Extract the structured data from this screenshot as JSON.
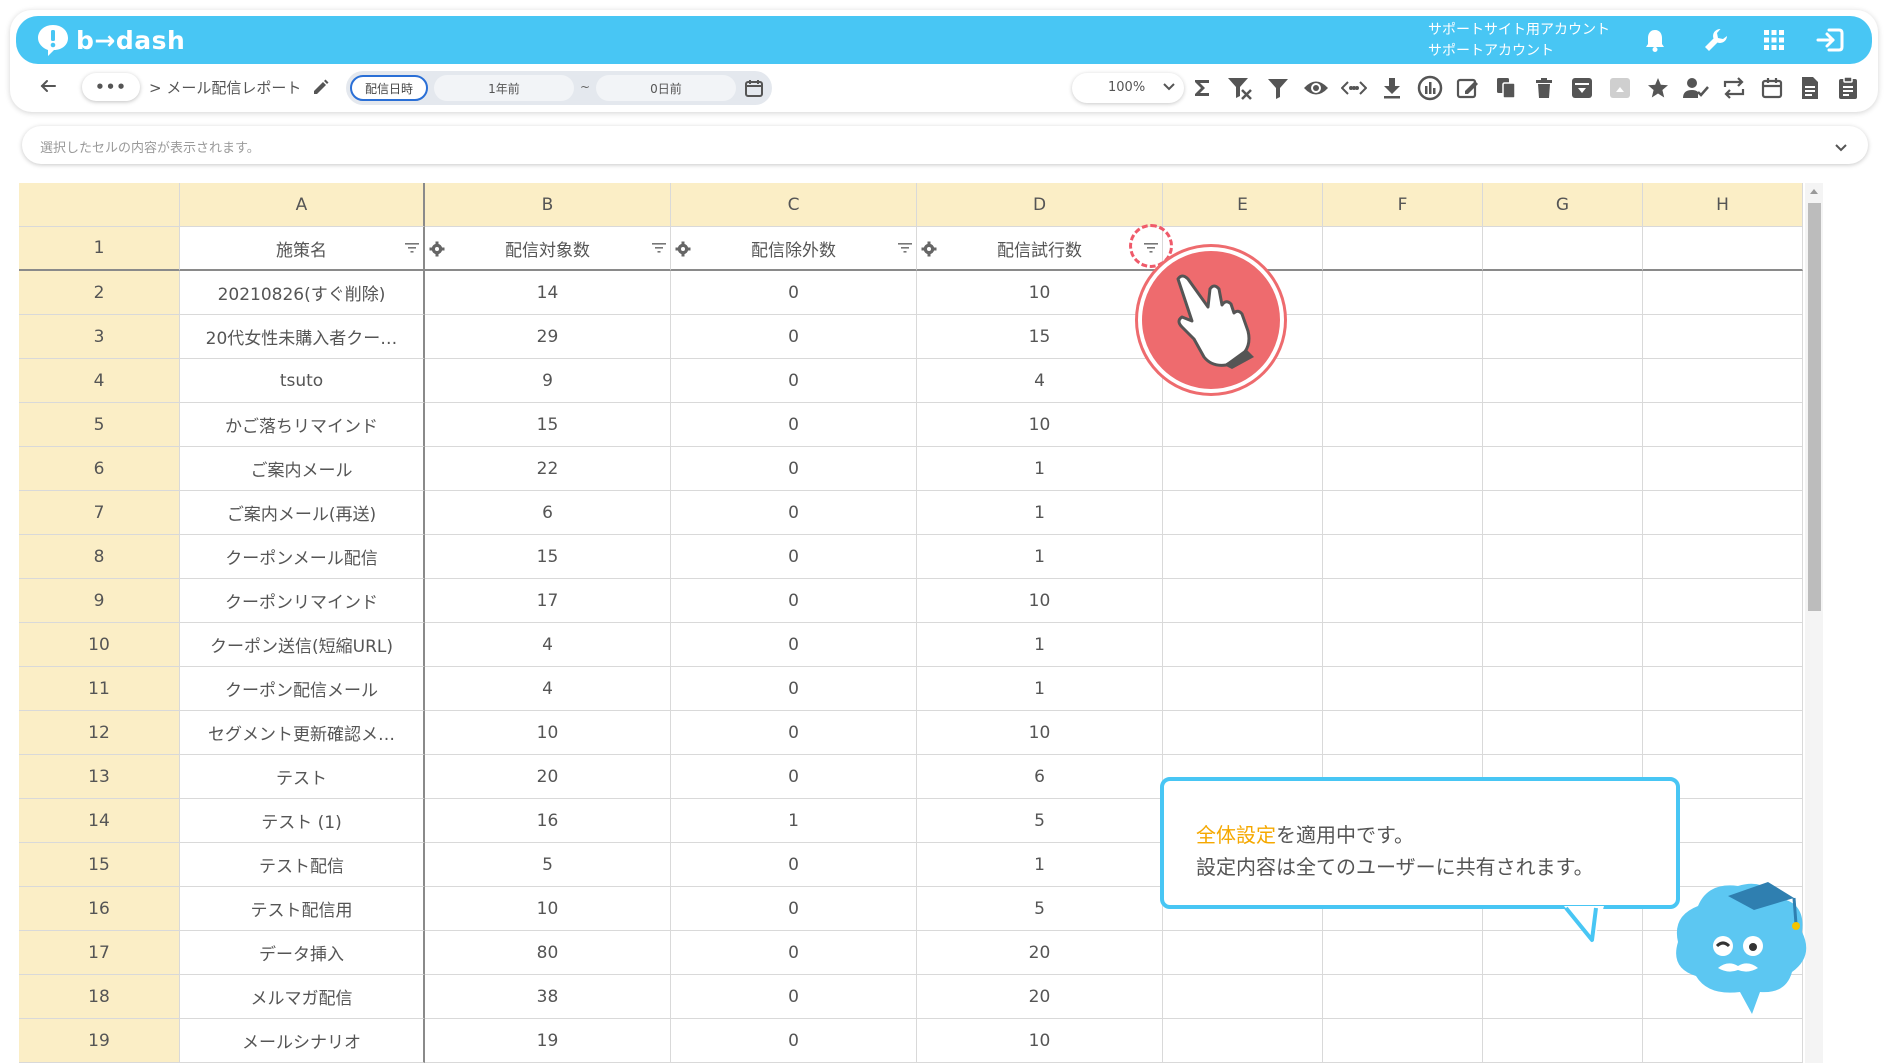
{
  "app": {
    "logo_text": "b→dash",
    "account_line1": "サポートサイト用アカウント",
    "account_line2": "サポートアカウント"
  },
  "toolbar": {
    "more": "•••",
    "breadcrumb": "> メール配信レポート",
    "date_label": "配信日時",
    "date_from": "1年前",
    "date_tilde": "~",
    "date_to": "0日前",
    "zoom": "100%",
    "tools": [
      "sigma-icon",
      "filter-clear-icon",
      "filter-icon",
      "eye-icon",
      "code-icon",
      "download-icon",
      "chart-icon",
      "edit-icon",
      "copy-icon",
      "trash-icon",
      "archive-icon",
      "unarchive-icon",
      "star-icon",
      "user-check-icon",
      "swap-icon",
      "calendar-icon",
      "document-icon",
      "clipboard-icon"
    ]
  },
  "cellbar": {
    "placeholder": "選択したセルの内容が表示されます。"
  },
  "grid": {
    "columns": [
      "A",
      "B",
      "C",
      "D",
      "E",
      "F",
      "G",
      "H"
    ],
    "field_headers": [
      "施策名",
      "配信対象数",
      "配信除外数",
      "配信試行数"
    ],
    "rows": [
      {
        "n": "2",
        "a": "20210826(すぐ削除)",
        "b": "14",
        "c": "0",
        "d": "10"
      },
      {
        "n": "3",
        "a": "20代女性未購入者クー…",
        "b": "29",
        "c": "0",
        "d": "15"
      },
      {
        "n": "4",
        "a": "tsuto",
        "b": "9",
        "c": "0",
        "d": "4"
      },
      {
        "n": "5",
        "a": "かご落ちリマインド",
        "b": "15",
        "c": "0",
        "d": "10"
      },
      {
        "n": "6",
        "a": "ご案内メール",
        "b": "22",
        "c": "0",
        "d": "1"
      },
      {
        "n": "7",
        "a": "ご案内メール(再送)",
        "b": "6",
        "c": "0",
        "d": "1"
      },
      {
        "n": "8",
        "a": "クーポンメール配信",
        "b": "15",
        "c": "0",
        "d": "1"
      },
      {
        "n": "9",
        "a": "クーポンリマインド",
        "b": "17",
        "c": "0",
        "d": "10"
      },
      {
        "n": "10",
        "a": "クーポン送信(短縮URL)",
        "b": "4",
        "c": "0",
        "d": "1"
      },
      {
        "n": "11",
        "a": "クーポン配信メール",
        "b": "4",
        "c": "0",
        "d": "1"
      },
      {
        "n": "12",
        "a": "セグメント更新確認メ…",
        "b": "10",
        "c": "0",
        "d": "10"
      },
      {
        "n": "13",
        "a": "テスト",
        "b": "20",
        "c": "0",
        "d": "6"
      },
      {
        "n": "14",
        "a": "テスト (1)",
        "b": "16",
        "c": "1",
        "d": "5"
      },
      {
        "n": "15",
        "a": "テスト配信",
        "b": "5",
        "c": "0",
        "d": "1"
      },
      {
        "n": "16",
        "a": "テスト配信用",
        "b": "10",
        "c": "0",
        "d": "5"
      },
      {
        "n": "17",
        "a": "データ挿入",
        "b": "80",
        "c": "0",
        "d": "20"
      },
      {
        "n": "18",
        "a": "メルマガ配信",
        "b": "38",
        "c": "0",
        "d": "20"
      },
      {
        "n": "19",
        "a": "メールシナリオ",
        "b": "19",
        "c": "0",
        "d": "10"
      }
    ]
  },
  "tooltip": {
    "highlight": "全体設定",
    "line1_rest": "を適用中です。",
    "line2": "設定内容は全てのユーザーに共有されます。"
  },
  "colors": {
    "accent": "#48c6f4",
    "header_bg": "#fbeec6",
    "highlight": "#f5a800",
    "pointer": "#ee6b6e"
  }
}
